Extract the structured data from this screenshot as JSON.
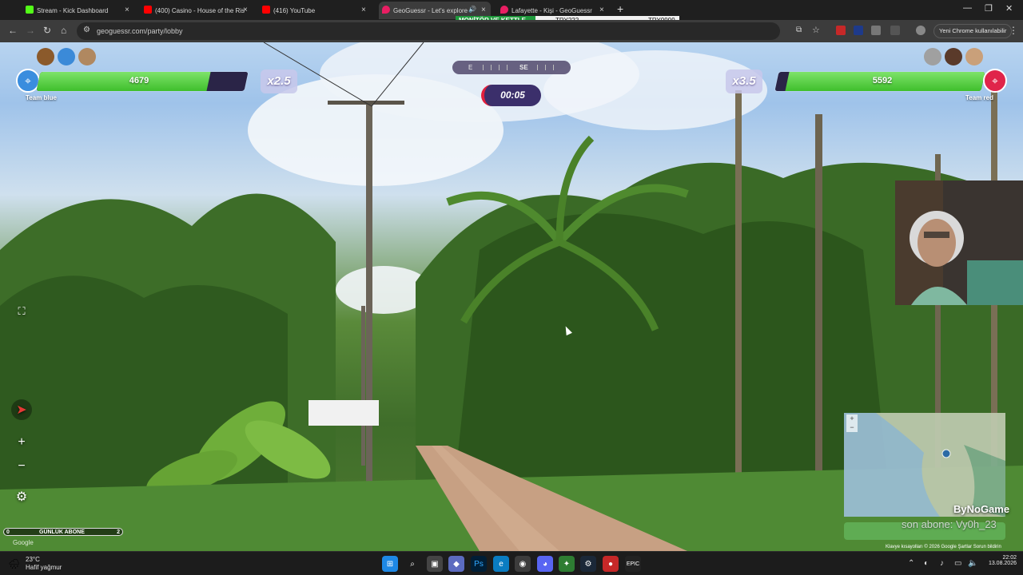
{
  "browser": {
    "tabs": [
      {
        "label": "Stream - Kick Dashboard",
        "favicon": "kick-icon",
        "color": "#53fc18"
      },
      {
        "label": "(400) Casino - House of the Ris",
        "favicon": "youtube-icon",
        "color": "#ff0000"
      },
      {
        "label": "(416) YouTube",
        "favicon": "youtube-icon",
        "color": "#ff0000"
      },
      {
        "label": "GeoGuessr - Let's explore t",
        "favicon": "geoguessr-icon",
        "color": "#e91e63",
        "active": true
      },
      {
        "label": "Lafayette - Kişi - GeoGuessr",
        "favicon": "geoguessr-icon",
        "color": "#e91e63"
      }
    ],
    "new_tab": "+",
    "url": "geoguessr.com/party/lobby",
    "chrome_message": "Yeni Chrome kullanılabilir"
  },
  "ticker": {
    "item1": "MONİTÖR VE KETTLE 🤞",
    "item2": "TRY222",
    "item3": "TRY9999"
  },
  "game": {
    "team_blue": {
      "name": "Team blue",
      "score": "4679",
      "fill_fraction": 0.82,
      "multiplier": "x2.5",
      "color": "#3a8dde"
    },
    "team_red": {
      "name": "Team red",
      "score": "5592",
      "fill_fraction": 0.95,
      "multiplier": "x3.5",
      "color": "#e0244a"
    },
    "compass": {
      "east": "E",
      "southeast": "SE"
    },
    "timer": "00:05"
  },
  "overlay": {
    "sub_counter": {
      "low": "0",
      "label": "GÜNLÜK ABONE",
      "high": "2"
    },
    "brand": "ByNoGame",
    "last_sub": "son abone: Vy0h_23",
    "google": "Google",
    "map_footer": "Klavye kısayolları  © 2026 Google  Şartlar  Sorun bildirin"
  },
  "taskbar": {
    "temp": "23°C",
    "weather": "Hafif yağmur",
    "time": "22:02",
    "date": "13.08.2026"
  }
}
